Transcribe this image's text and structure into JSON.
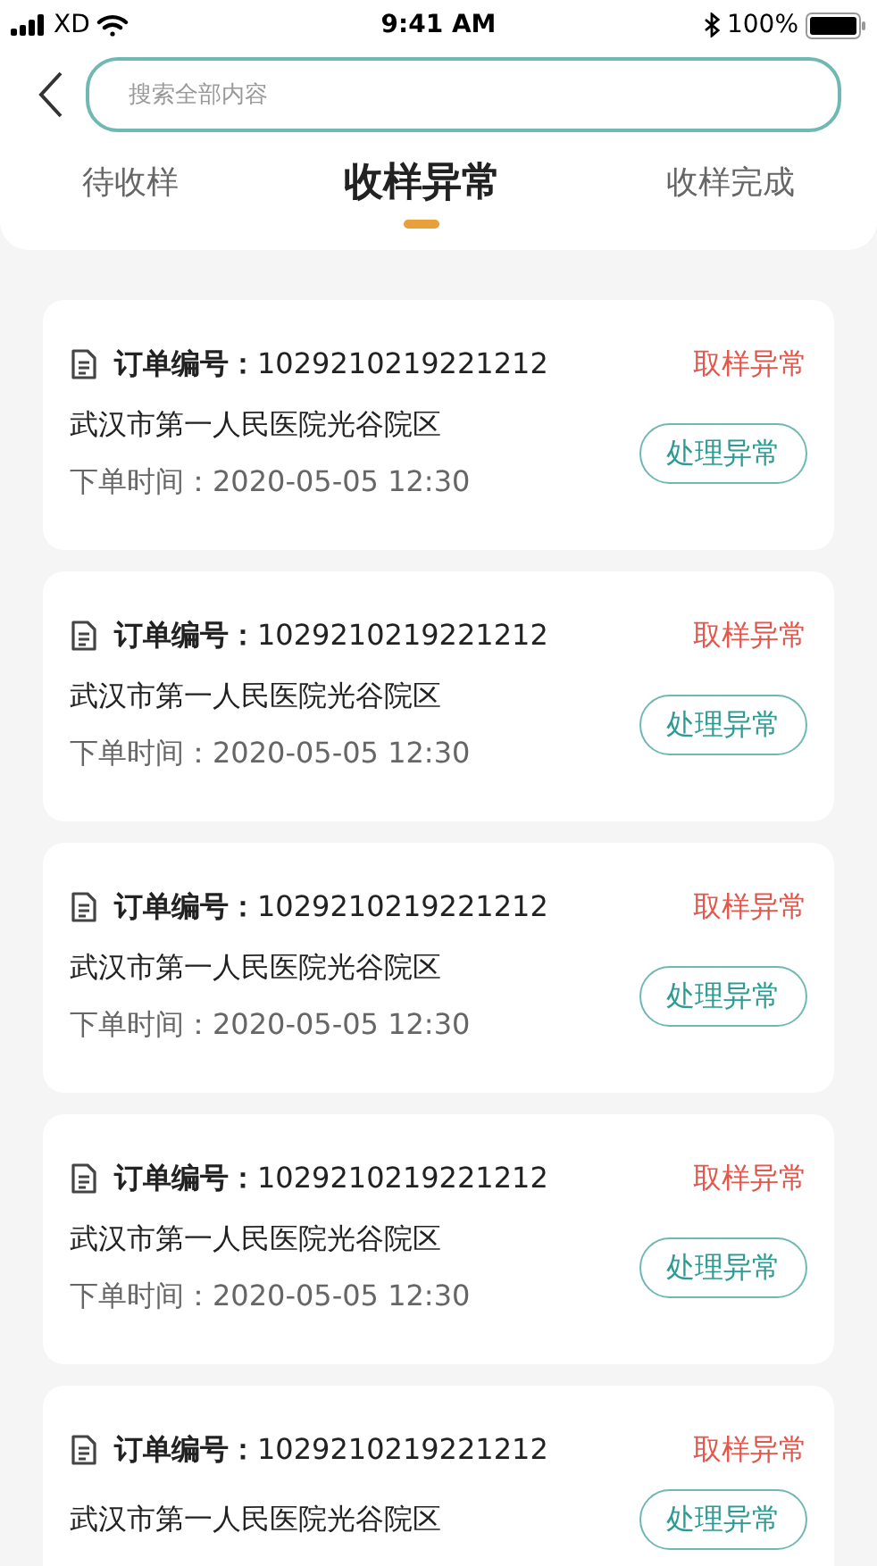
{
  "status_bar": {
    "carrier": "XD",
    "time": "9:41 AM",
    "battery": "100%"
  },
  "search": {
    "placeholder": "搜索全部内容"
  },
  "tabs": [
    {
      "label": "待收样",
      "selected": false
    },
    {
      "label": "收样异常",
      "selected": true
    },
    {
      "label": "收样完成",
      "selected": false
    }
  ],
  "orders": [
    {
      "order_no": "**订单编号：**1029210219221212",
      "status": "取样异常",
      "hospital": "武汉市第一人民医院光谷院区",
      "time": "下单时间：2020-05-05 12:30",
      "action": "处理异常"
    },
    {
      "order_no": "**订单编号：**1029210219221212",
      "status": "取样异常",
      "hospital": "武汉市第一人民医院光谷院区",
      "time": "下单时间：2020-05-05 12:30",
      "action": "处理异常"
    },
    {
      "order_no": "**订单编号：**1029210219221212",
      "status": "取样异常",
      "hospital": "武汉市第一人民医院光谷院区",
      "time": "下单时间：2020-05-05 12:30",
      "action": "处理异常"
    },
    {
      "order_no": "**订单编号：**1029210219221212",
      "status": "取样异常",
      "hospital": "武汉市第一人民医院光谷院区",
      "time": "下单时间：2020-05-05 12:30",
      "action": "处理异常"
    },
    {
      "order_no": "**订单编号：**1029210219221212",
      "status": "取样异常",
      "hospital": "武汉市第一人民医院光谷院区",
      "action": "处理异常"
    }
  ]
}
